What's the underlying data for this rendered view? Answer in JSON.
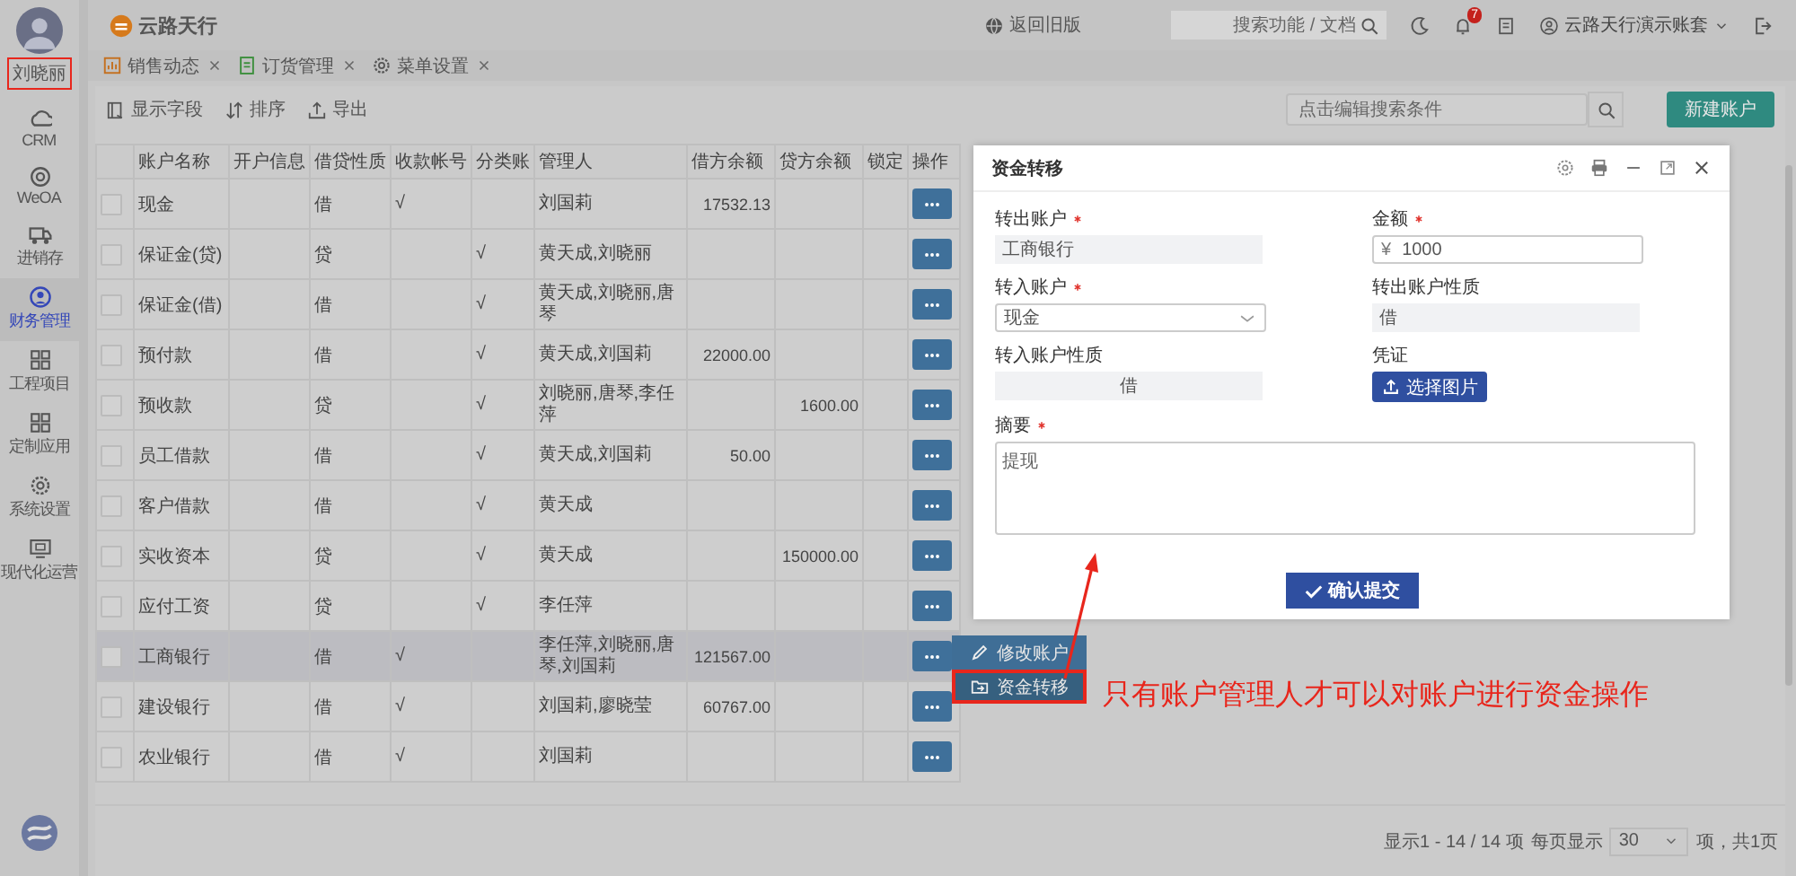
{
  "sidebar": {
    "user": {
      "name": "刘晓丽",
      "boxed": true
    },
    "items": [
      {
        "label": "CRM",
        "selected": false
      },
      {
        "label": "WeOA",
        "selected": false
      },
      {
        "label": "进销存",
        "selected": false
      },
      {
        "label": "财务管理",
        "selected": true
      },
      {
        "label": "工程项目",
        "selected": false
      },
      {
        "label": "定制应用",
        "selected": false
      },
      {
        "label": "系统设置",
        "selected": false
      },
      {
        "label": "现代化运营",
        "selected": false
      }
    ]
  },
  "header": {
    "brand": "云路天行",
    "old_version": "返回旧版",
    "search": {
      "placeholder": "搜索功能 / 文档"
    },
    "notifications": "7",
    "account": "云路天行演示账套"
  },
  "tabs": [
    {
      "label": "销售动态",
      "selected": false
    },
    {
      "label": "订货管理",
      "selected": false
    },
    {
      "label": "菜单设置",
      "selected": false
    }
  ],
  "toolbar": {
    "actions": [
      "显示字段",
      "排序",
      "导出"
    ],
    "search": {
      "placeholder": "点击编辑搜索条件"
    },
    "new_button": "新建账户"
  },
  "table": {
    "columns": [
      "账户名称",
      "开户信息",
      "借贷性质",
      "收款帐号",
      "分类账",
      "管理人",
      "借方余额",
      "贷方余额",
      "锁定",
      "操作"
    ],
    "rows": [
      {
        "name": "现金",
        "nature": "借",
        "receipt": "√",
        "managers": "刘国莉",
        "debit": "17532.13",
        "checked": false,
        "selected": false
      },
      {
        "name": "保证金(贷)",
        "nature": "贷",
        "ledger": "√",
        "managers": "黄天成,刘晓丽",
        "checked": false,
        "selected": false
      },
      {
        "name": "保证金(借)",
        "nature": "借",
        "ledger": "√",
        "managers": "黄天成,刘晓丽,唐琴",
        "checked": false,
        "selected": false
      },
      {
        "name": "预付款",
        "nature": "借",
        "ledger": "√",
        "managers": "黄天成,刘国莉",
        "debit": "22000.00",
        "checked": false,
        "selected": false
      },
      {
        "name": "预收款",
        "nature": "贷",
        "ledger": "√",
        "managers": "刘晓丽,唐琴,李任萍",
        "credit": "1600.00",
        "checked": false,
        "selected": false
      },
      {
        "name": "员工借款",
        "nature": "借",
        "ledger": "√",
        "managers": "黄天成,刘国莉",
        "debit": "50.00",
        "checked": false,
        "selected": false
      },
      {
        "name": "客户借款",
        "nature": "借",
        "ledger": "√",
        "managers": "黄天成",
        "checked": false,
        "selected": false
      },
      {
        "name": "实收资本",
        "nature": "贷",
        "ledger": "√",
        "managers": "黄天成",
        "credit": "150000.00",
        "checked": false,
        "selected": false
      },
      {
        "name": "应付工资",
        "nature": "贷",
        "ledger": "√",
        "managers": "李任萍",
        "checked": false,
        "selected": false
      },
      {
        "name": "工商银行",
        "nature": "借",
        "receipt": "√",
        "managers": "李任萍,刘晓丽,唐琴,刘国莉",
        "debit": "121567.00",
        "checked": false,
        "selected": true
      },
      {
        "name": "建设银行",
        "nature": "借",
        "receipt": "√",
        "managers": "刘国莉,廖晓莹",
        "debit": "60767.00",
        "checked": false,
        "selected": false
      },
      {
        "name": "农业银行",
        "nature": "借",
        "receipt": "√",
        "managers": "刘国莉",
        "checked": false,
        "selected": false
      }
    ]
  },
  "row_menu": {
    "items": [
      {
        "label": "修改账户",
        "boxed": false
      },
      {
        "label": "资金转移",
        "boxed": true
      }
    ]
  },
  "dialog": {
    "title": "资金转移",
    "fields": [
      {
        "kind": "readonly",
        "label": "转出账户",
        "required": true,
        "value": "工商银行"
      },
      {
        "kind": "money",
        "label": "金额",
        "required": true,
        "prefix": "¥",
        "value": "1000"
      },
      {
        "kind": "select",
        "label": "转入账户",
        "required": true,
        "value": "现金"
      },
      {
        "kind": "readonly",
        "label": "转出账户性质",
        "required": false,
        "value": "借"
      },
      {
        "kind": "display",
        "label": "转入账户性质",
        "required": false,
        "value": "借"
      },
      {
        "kind": "upload",
        "label": "凭证",
        "required": false,
        "button": "选择图片"
      },
      {
        "kind": "textarea",
        "label": "摘要",
        "required": true,
        "value": "提现"
      }
    ],
    "submit": "确认提交"
  },
  "annotation": {
    "text": "只有账户管理人才可以对账户进行资金操作"
  },
  "pagination": {
    "summary": "显示1 - 14 / 14 项",
    "per_page_label": "每页显示",
    "per_page": "30",
    "total_pages": "项，共1页"
  }
}
